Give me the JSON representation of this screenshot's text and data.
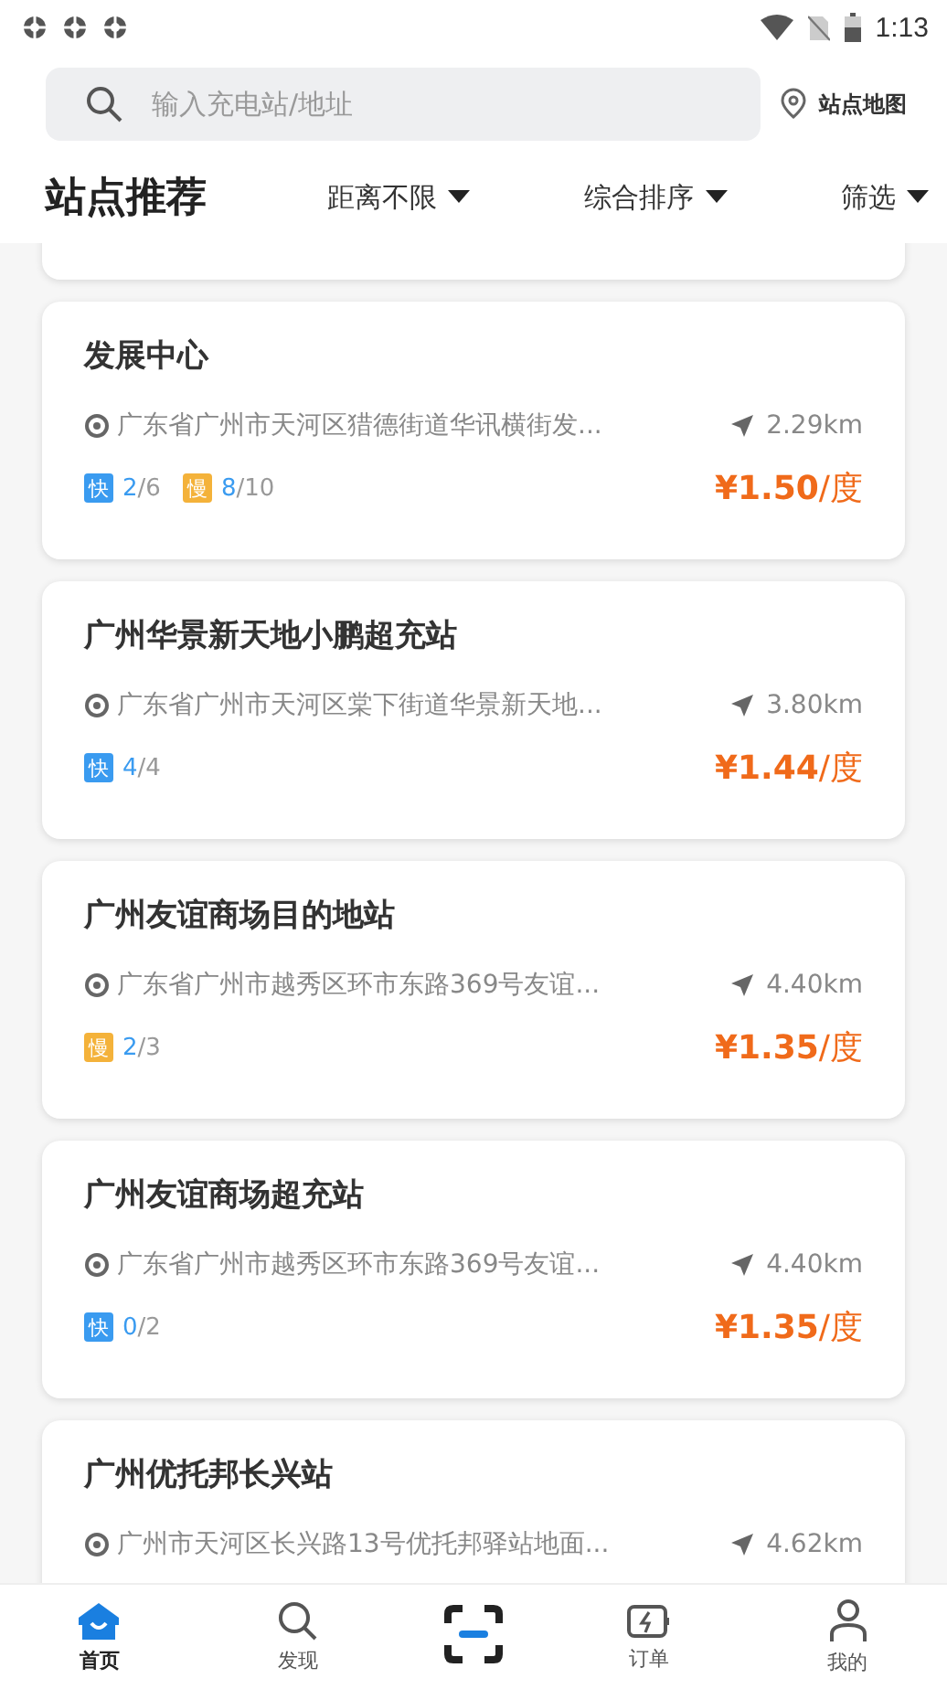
{
  "status_bar": {
    "time": "1:13"
  },
  "search": {
    "placeholder": "输入充电站/地址"
  },
  "map_link": "站点地图",
  "header": {
    "title": "站点推荐",
    "filters": [
      "距离不限",
      "综合排序",
      "筛选"
    ]
  },
  "stations": [
    {
      "name": "发展中心",
      "address": "广东省广州市天河区猎德街道华讯横街发...",
      "distance": "2.29km",
      "chargers": [
        {
          "kind": "fast",
          "label": "快",
          "available": "2",
          "total": "/6"
        },
        {
          "kind": "slow",
          "label": "慢",
          "available": "8",
          "total": "/10"
        }
      ],
      "price": "¥1.50",
      "unit": "/度"
    },
    {
      "name": "广州华景新天地小鹏超充站",
      "address": "广东省广州市天河区棠下街道华景新天地...",
      "distance": "3.80km",
      "chargers": [
        {
          "kind": "fast",
          "label": "快",
          "available": "4",
          "total": "/4"
        }
      ],
      "price": "¥1.44",
      "unit": "/度"
    },
    {
      "name": "广州友谊商场目的地站",
      "address": "广东省广州市越秀区环市东路369号友谊...",
      "distance": "4.40km",
      "chargers": [
        {
          "kind": "slow",
          "label": "慢",
          "available": "2",
          "total": "/3"
        }
      ],
      "price": "¥1.35",
      "unit": "/度"
    },
    {
      "name": "广州友谊商场超充站",
      "address": "广东省广州市越秀区环市东路369号友谊...",
      "distance": "4.40km",
      "chargers": [
        {
          "kind": "fast",
          "label": "快",
          "available": "0",
          "total": "/2"
        }
      ],
      "price": "¥1.35",
      "unit": "/度"
    },
    {
      "name": "广州优托邦长兴站",
      "address": "广州市天河区长兴路13号优托邦驿站地面...",
      "distance": "4.62km"
    }
  ],
  "nav": [
    {
      "kind": "home",
      "label": "首页",
      "selected": true
    },
    {
      "kind": "search",
      "label": "发现",
      "selected": false
    },
    {
      "kind": "scan"
    },
    {
      "kind": "order",
      "label": "订单",
      "selected": false
    },
    {
      "kind": "user",
      "label": "我的",
      "selected": false
    }
  ]
}
